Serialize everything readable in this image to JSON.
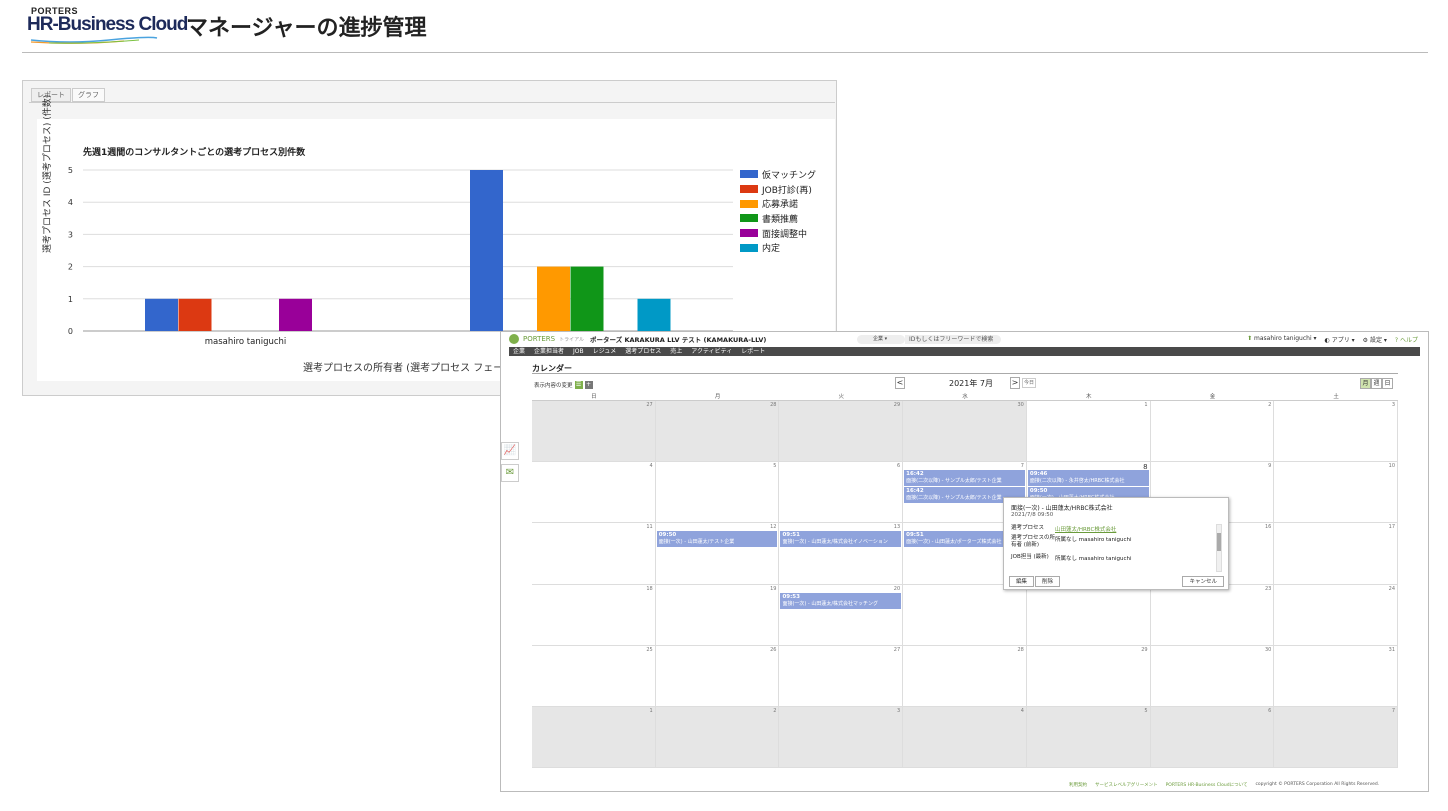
{
  "header": {
    "logo_top": "PORTERS",
    "logo_main": "HR-Business Cloud",
    "title": "マネージャーの進捗管理"
  },
  "report": {
    "tabs": [
      {
        "label": "レポート"
      },
      {
        "label": "グラフ"
      }
    ],
    "active_tab": "グラフ"
  },
  "chart_data": {
    "type": "bar",
    "title": "先週1週間のコンサルタントごとの選考プロセス別件数",
    "xlabel": "選考プロセスの所有者 (選考プロセス フェーズ履",
    "ylabel": "選考プロセス ID (選考プロセス) (件数)",
    "categories": [
      "masahiro taniguchi",
      ""
    ],
    "ylim": [
      0,
      5
    ],
    "yticks": [
      "0",
      "1",
      "2",
      "3",
      "4",
      "5"
    ],
    "grid": true,
    "legend_position": "right",
    "series": [
      {
        "name": "仮マッチング",
        "color": "#3366cc",
        "values": [
          1,
          5
        ]
      },
      {
        "name": "JOB打診(再)",
        "color": "#dc3912",
        "values": [
          1,
          0
        ]
      },
      {
        "name": "応募承諾",
        "color": "#ff9900",
        "values": [
          0,
          2
        ]
      },
      {
        "name": "書類推薦",
        "color": "#109618",
        "values": [
          0,
          2
        ]
      },
      {
        "name": "面接調整中",
        "color": "#990099",
        "values": [
          1,
          0
        ]
      },
      {
        "name": "内定",
        "color": "#0099c6",
        "values": [
          0,
          1
        ]
      }
    ]
  },
  "calendar": {
    "brand": "PORTERS",
    "trial": "トライアル",
    "org": "ポーターズ KARAKURA LLV テスト (KAMAKURA-LLV)",
    "search_select": "企業",
    "search_placeholder": "IDもしくはフリーワードで検索",
    "user": "masahiro taniguchi ▾",
    "apps": "アプリ ▾",
    "settings": "設定 ▾",
    "help": "ヘルプ",
    "nav": [
      "企業",
      "企業担当者",
      "JOB",
      "レジュメ",
      "選考プロセス",
      "売上",
      "アクティビティ",
      "レポート"
    ],
    "title": "カレンダー",
    "view_change": "表示内容の変更",
    "month": "2021年 7月",
    "prev": "<",
    "next": ">",
    "today": "今日",
    "views": [
      "月",
      "週",
      "日"
    ],
    "weekdays": [
      "日",
      "月",
      "火",
      "水",
      "木",
      "金",
      "土"
    ],
    "weeks": [
      [
        {
          "n": "27",
          "o": true
        },
        {
          "n": "28",
          "o": true
        },
        {
          "n": "29",
          "o": true
        },
        {
          "n": "30",
          "o": true
        },
        {
          "n": "1"
        },
        {
          "n": "2"
        },
        {
          "n": "3"
        }
      ],
      [
        {
          "n": "4"
        },
        {
          "n": "5"
        },
        {
          "n": "6"
        },
        {
          "n": "7"
        },
        {
          "n": "8",
          "big": true
        },
        {
          "n": "9"
        },
        {
          "n": "10"
        }
      ],
      [
        {
          "n": "11"
        },
        {
          "n": "12"
        },
        {
          "n": "13"
        },
        {
          "n": "14"
        },
        {
          "n": "15"
        },
        {
          "n": "16"
        },
        {
          "n": "17"
        }
      ],
      [
        {
          "n": "18"
        },
        {
          "n": "19"
        },
        {
          "n": "20"
        },
        {
          "n": "21"
        },
        {
          "n": "22"
        },
        {
          "n": "23"
        },
        {
          "n": "24"
        }
      ],
      [
        {
          "n": "25"
        },
        {
          "n": "26"
        },
        {
          "n": "27"
        },
        {
          "n": "28"
        },
        {
          "n": "29"
        },
        {
          "n": "30"
        },
        {
          "n": "31"
        }
      ],
      [
        {
          "n": "1",
          "o": true
        },
        {
          "n": "2",
          "o": true
        },
        {
          "n": "3",
          "o": true
        },
        {
          "n": "4",
          "o": true
        },
        {
          "n": "5",
          "o": true
        },
        {
          "n": "6",
          "o": true
        },
        {
          "n": "7",
          "o": true
        }
      ]
    ],
    "events": [
      {
        "w": 1,
        "d": 3,
        "slot": 0,
        "time": "16:42",
        "text": "面接(二次以降) - サンプル太郎/テスト企業"
      },
      {
        "w": 1,
        "d": 3,
        "slot": 1,
        "time": "16:42",
        "text": "面接(二次以降) - サンプル太郎/テスト企業"
      },
      {
        "w": 1,
        "d": 4,
        "slot": 0,
        "time": "09:46",
        "text": "面接(二次以降) - 永井啓太/HRBC株式会社"
      },
      {
        "w": 1,
        "d": 4,
        "slot": 1,
        "time": "09:50",
        "text": "面接(一次) - 山田蓮太/HRBC株式会社"
      },
      {
        "w": 2,
        "d": 1,
        "slot": 0,
        "time": "09:50",
        "text": "面接(一次) - 山田蓮太/テスト企業"
      },
      {
        "w": 2,
        "d": 2,
        "slot": 0,
        "time": "09:51",
        "text": "面接(一次) - 山田蓮太/株式会社イノベーション"
      },
      {
        "w": 2,
        "d": 3,
        "slot": 0,
        "time": "09:51",
        "text": "面接(一次) - 山田蓮太/ポーターズ株式会社"
      },
      {
        "w": 3,
        "d": 2,
        "slot": 0,
        "time": "09:53",
        "text": "面接(一次) - 山田蓮太/株式会社マッチング"
      }
    ],
    "popup": {
      "title": "面接(一次) - 山田蓮太/HRBC株式会社",
      "date": "2021/7/8 09:50",
      "rows": [
        {
          "k": "選考プロセス",
          "v": "山田蓮太/HRBC株式会社",
          "link": true
        },
        {
          "k": "選考プロセスの所有者 (前新)",
          "v": "所属なし masahiro taniguchi"
        },
        {
          "k": "JOB担当 (最新)",
          "v": "所属なし masahiro taniguchi"
        }
      ],
      "edit": "編集",
      "delete": "削除",
      "cancel": "キャンセル"
    },
    "footer": [
      "利用契約",
      "サービスレベルアグリーメント",
      "PORTERS HR-Business Cloudについて"
    ],
    "copyright": "copyright © PORTERS Corporation All Rights Reserved."
  }
}
